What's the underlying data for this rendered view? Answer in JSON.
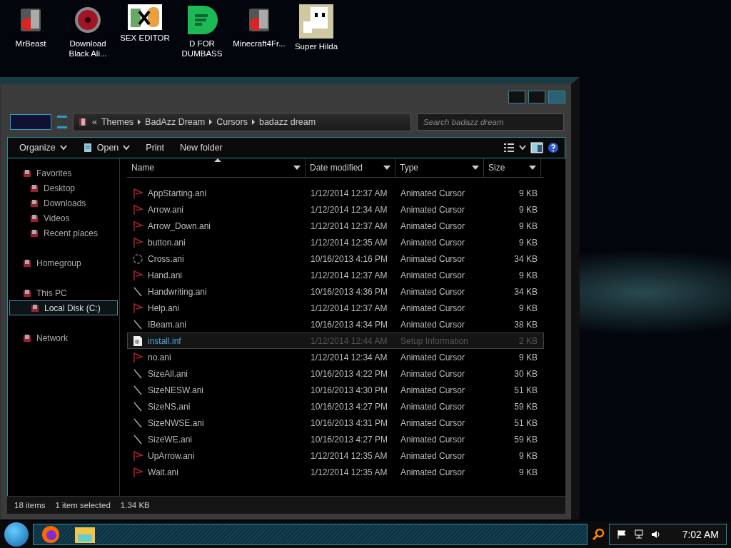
{
  "desktop_icons": [
    {
      "label": "MrBeast",
      "kind": "app"
    },
    {
      "label": "Download Black Ali...",
      "kind": "disc"
    },
    {
      "label": "SEX EDITOR",
      "kind": "hxd"
    },
    {
      "label": "D FOR DUMBASS",
      "kind": "green"
    },
    {
      "label": "Minecraft4Fr...",
      "kind": "app"
    },
    {
      "label": "Super Hilda",
      "kind": "pixel"
    }
  ],
  "address_bar": {
    "overflow": "«",
    "crumbs": [
      "Themes",
      "BadAzz Dream",
      "Cursors",
      "badazz dream"
    ]
  },
  "search": {
    "placeholder": "Search badazz dream"
  },
  "toolbar": [
    {
      "label": "Organize",
      "dropdown": true,
      "icon": false
    },
    {
      "label": "Open",
      "dropdown": true,
      "icon": true
    },
    {
      "label": "Print",
      "dropdown": false,
      "icon": false
    },
    {
      "label": "New folder",
      "dropdown": false,
      "icon": false
    }
  ],
  "sidebar": [
    {
      "label": "Favorites",
      "children": [
        {
          "label": "Desktop",
          "selected": false
        },
        {
          "label": "Downloads",
          "selected": false
        },
        {
          "label": "Videos",
          "selected": false
        },
        {
          "label": "Recent places",
          "selected": false
        }
      ]
    },
    {
      "label": "Homegroup"
    },
    {
      "label": "This PC",
      "children": [
        {
          "label": "Local Disk (C:)",
          "selected": true
        }
      ]
    },
    {
      "label": "Network"
    }
  ],
  "columns": [
    {
      "label": "Name",
      "sorted": true
    },
    {
      "label": "Date modified",
      "sorted": false
    },
    {
      "label": "Type",
      "sorted": false
    },
    {
      "label": "Size",
      "sorted": false
    }
  ],
  "rows": [
    {
      "name": "AppStarting.ani",
      "date": "1/12/2014 12:37 AM",
      "type": "Animated Cursor",
      "size": "9 KB",
      "kind": "cursor",
      "selected": false
    },
    {
      "name": "Arrow.ani",
      "date": "1/12/2014 12:34 AM",
      "type": "Animated Cursor",
      "size": "9 KB",
      "kind": "cursor",
      "selected": false
    },
    {
      "name": "Arrow_Down.ani",
      "date": "1/12/2014 12:37 AM",
      "type": "Animated Cursor",
      "size": "9 KB",
      "kind": "cursor",
      "selected": false
    },
    {
      "name": "button.ani",
      "date": "1/12/2014 12:35 AM",
      "type": "Animated Cursor",
      "size": "9 KB",
      "kind": "cursor",
      "selected": false
    },
    {
      "name": "Cross.ani",
      "date": "10/16/2013 4:16 PM",
      "type": "Animated Cursor",
      "size": "34 KB",
      "kind": "ring",
      "selected": false
    },
    {
      "name": "Hand.ani",
      "date": "1/12/2014 12:37 AM",
      "type": "Animated Cursor",
      "size": "9 KB",
      "kind": "cursor",
      "selected": false
    },
    {
      "name": "Handwriting.ani",
      "date": "10/16/2013 4:36 PM",
      "type": "Animated Cursor",
      "size": "34 KB",
      "kind": "line",
      "selected": false
    },
    {
      "name": "Help.ani",
      "date": "1/12/2014 12:37 AM",
      "type": "Animated Cursor",
      "size": "9 KB",
      "kind": "cursor",
      "selected": false
    },
    {
      "name": "IBeam.ani",
      "date": "10/16/2013 4:34 PM",
      "type": "Animated Cursor",
      "size": "38 KB",
      "kind": "line",
      "selected": false
    },
    {
      "name": "install.inf",
      "date": "1/12/2014 12:44 AM",
      "type": "Setup Information",
      "size": "2 KB",
      "kind": "setup",
      "selected": true
    },
    {
      "name": "no.ani",
      "date": "1/12/2014 12:34 AM",
      "type": "Animated Cursor",
      "size": "9 KB",
      "kind": "cursor",
      "selected": false
    },
    {
      "name": "SizeAll.ani",
      "date": "10/16/2013 4:22 PM",
      "type": "Animated Cursor",
      "size": "30 KB",
      "kind": "line",
      "selected": false
    },
    {
      "name": "SizeNESW.ani",
      "date": "10/16/2013 4:30 PM",
      "type": "Animated Cursor",
      "size": "51 KB",
      "kind": "line",
      "selected": false
    },
    {
      "name": "SizeNS.ani",
      "date": "10/16/2013 4:27 PM",
      "type": "Animated Cursor",
      "size": "59 KB",
      "kind": "line",
      "selected": false
    },
    {
      "name": "SizeNWSE.ani",
      "date": "10/16/2013 4:31 PM",
      "type": "Animated Cursor",
      "size": "51 KB",
      "kind": "line",
      "selected": false
    },
    {
      "name": "SizeWE.ani",
      "date": "10/16/2013 4:27 PM",
      "type": "Animated Cursor",
      "size": "59 KB",
      "kind": "line",
      "selected": false
    },
    {
      "name": "UpArrow.ani",
      "date": "1/12/2014 12:35 AM",
      "type": "Animated Cursor",
      "size": "9 KB",
      "kind": "cursor",
      "selected": false
    },
    {
      "name": "Wait.ani",
      "date": "1/12/2014 12:35 AM",
      "type": "Animated Cursor",
      "size": "9 KB",
      "kind": "cursor",
      "selected": false
    }
  ],
  "status_bar": {
    "item_count": "18 items",
    "selection": "1 item selected",
    "selection_size": "1.34 KB"
  },
  "taskbar": {
    "clock": "7:02 AM"
  }
}
